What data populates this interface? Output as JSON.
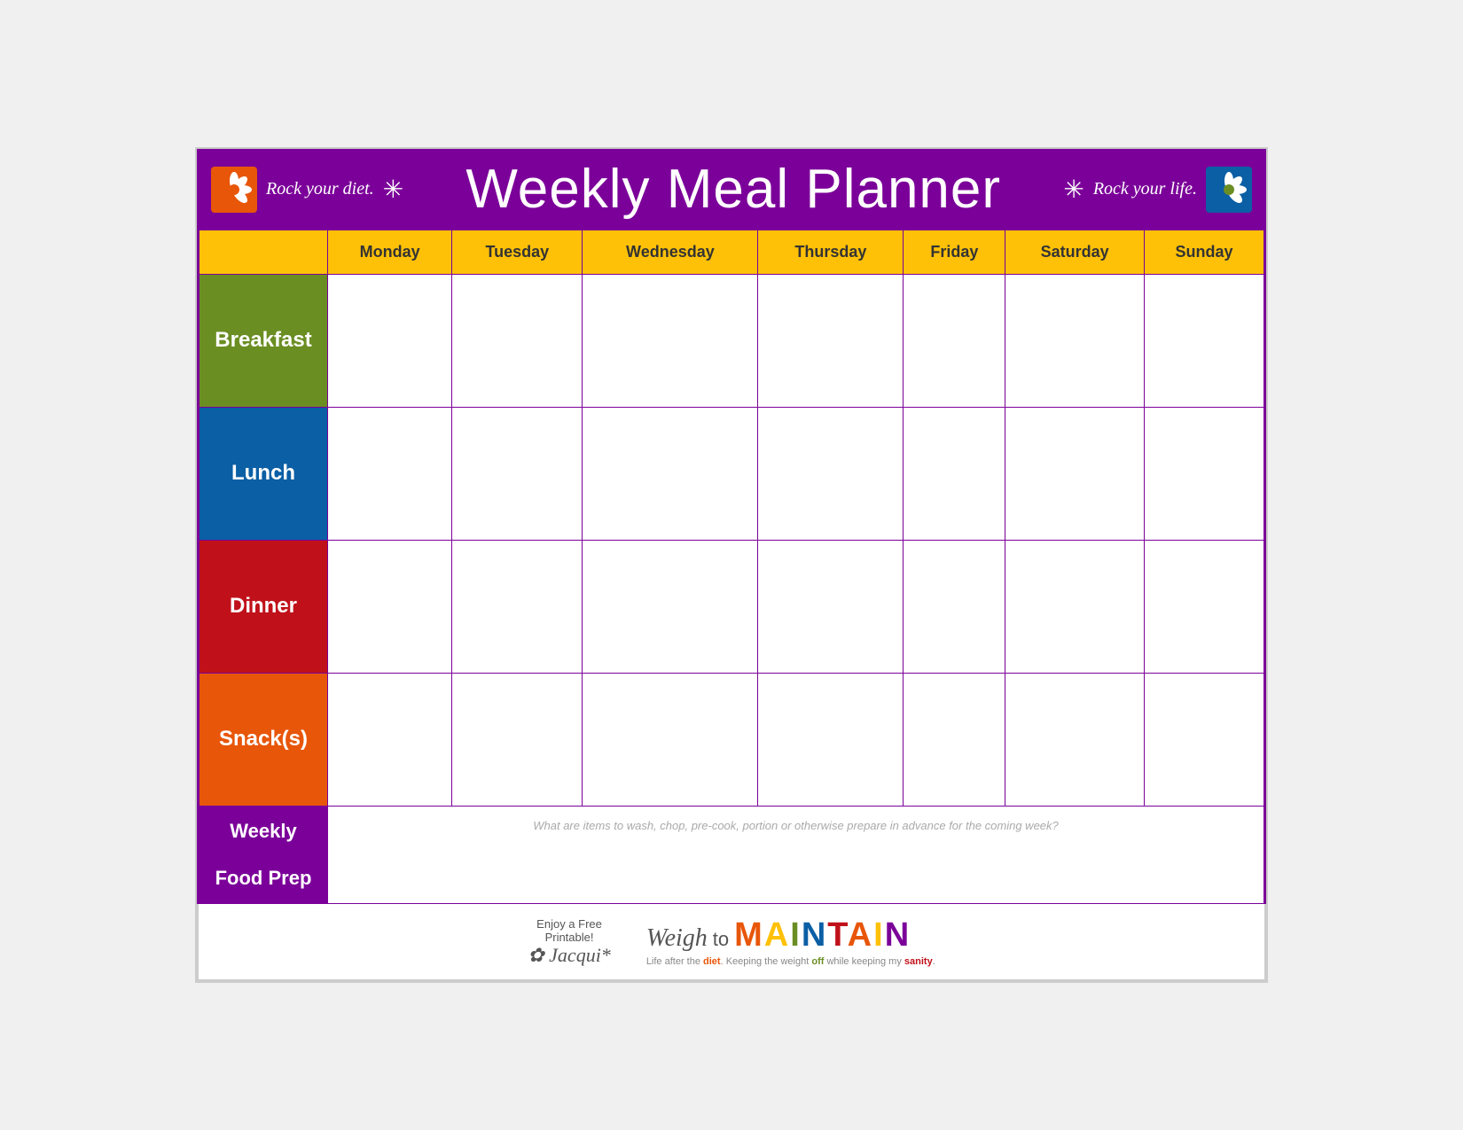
{
  "header": {
    "tagline_left": "Rock your diet.",
    "title": "Weekly Meal Planner",
    "tagline_right": "Rock your life.",
    "asterisk": "✳"
  },
  "days": {
    "empty": "",
    "monday": "Monday",
    "tuesday": "Tuesday",
    "wednesday": "Wednesday",
    "thursday": "Thursday",
    "friday": "Friday",
    "saturday": "Saturday",
    "sunday": "Sunday"
  },
  "rows": {
    "breakfast": "Breakfast",
    "lunch": "Lunch",
    "dinner": "Dinner",
    "snacks": "Snack(s)",
    "weekly_food_prep_line1": "Weekly",
    "weekly_food_prep_line2": "Food Prep"
  },
  "weekly_prep_hint": "What are items to wash, chop, pre-cook, portion or otherwise prepare in advance for the coming week?",
  "footer": {
    "enjoy_line1": "Enjoy a Free",
    "enjoy_line2": "Printable!",
    "jacqui": "✿ Jacqui*",
    "weigh": "Weigh",
    "to": "to",
    "maintain": "MAINTAIN",
    "tagline": "Life after the diet. Keeping the weight off while keeping my sanity."
  },
  "colors": {
    "purple": "#7B0099",
    "yellow": "#FFC107",
    "green": "#6B8E23",
    "blue": "#0B5FA5",
    "red": "#C0111A",
    "orange": "#E8560A"
  }
}
